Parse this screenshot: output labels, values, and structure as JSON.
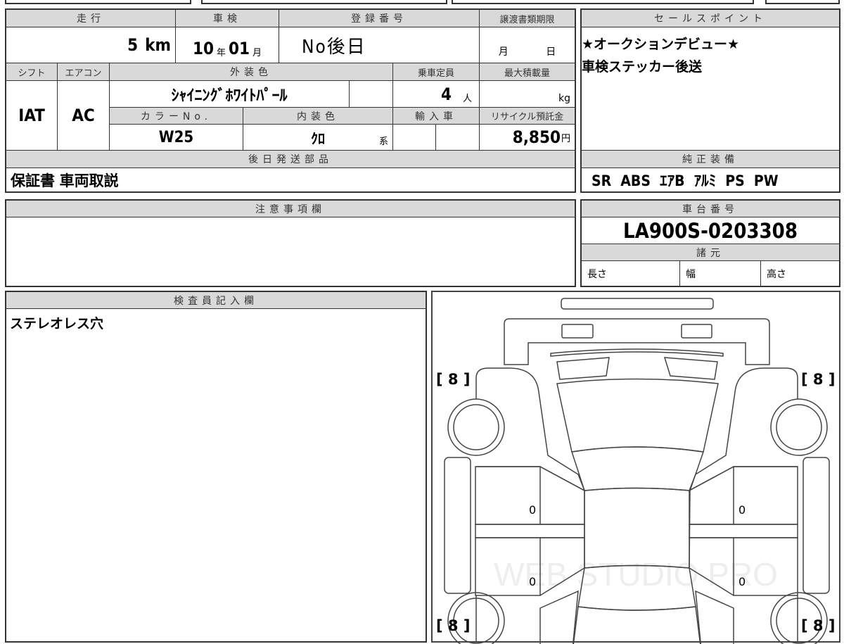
{
  "main": {
    "mileage_label": "走行",
    "mileage_value": "5",
    "mileage_unit": "km",
    "inspection_label": "車検",
    "inspection_year": "10",
    "inspection_year_unit": "年",
    "inspection_month": "01",
    "inspection_month_unit": "月",
    "registration_label": "登録番号",
    "registration_value": "No後日",
    "transfer_deadline_label": "譲渡書類期限",
    "transfer_month_unit": "月",
    "transfer_day_unit": "日",
    "shift_label": "シフト",
    "shift_value": "IAT",
    "ac_label": "エアコン",
    "ac_value": "AC",
    "exterior_color_label": "外装色",
    "exterior_color_value": "ｼｬｲﾆﾝｸﾞﾎﾜｲﾄﾊﾟｰﾙ",
    "capacity_label": "乗車定員",
    "capacity_value": "4",
    "capacity_unit": "人",
    "max_load_label": "最大積載量",
    "max_load_unit": "kg",
    "color_no_label": "カラーNo.",
    "color_no_value": "W25",
    "interior_color_label": "内装色",
    "interior_color_value": "ｸﾛ",
    "interior_color_suffix": "系",
    "import_label": "輸入車",
    "recycle_label": "リサイクル預託金",
    "recycle_value": "8,850",
    "recycle_unit": "円",
    "later_parts_label": "後日発送部品",
    "later_parts_value": "保証書 車両取説"
  },
  "sales_point": {
    "label": "セールスポイント",
    "lines": [
      "★オークションデビュー★",
      "車検ステッカー後送"
    ]
  },
  "equipment": {
    "label": "純正装備",
    "value": "SR  ABS  ｴｱB  ｱﾙﾐ  PS  PW"
  },
  "notes": {
    "label": "注意事項欄"
  },
  "chassis": {
    "label": "車台番号",
    "value": "LA900S-0203308",
    "specs_label": "諸元",
    "length_label": "長さ",
    "width_label": "幅",
    "height_label": "高さ"
  },
  "inspector": {
    "label": "検査員記入欄",
    "value": "ステレオレス穴"
  },
  "diagram": {
    "tire_tread": [
      "[ 8 ]",
      "[ 8 ]",
      "[ 8 ]",
      "[ 8 ]"
    ],
    "door_marks": [
      "0",
      "0",
      "0",
      "0"
    ],
    "watermark": "WEB STUDIO PRO"
  }
}
